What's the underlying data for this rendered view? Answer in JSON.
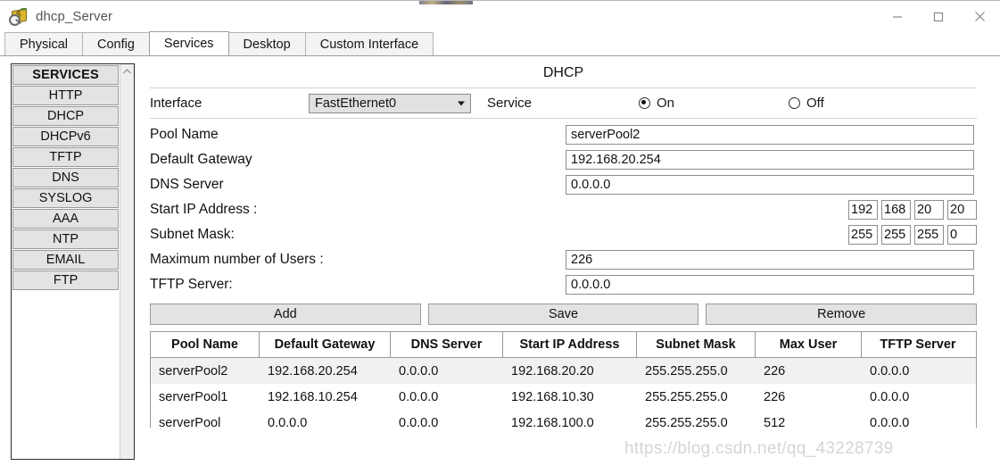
{
  "window": {
    "title": "dhcp_Server",
    "icon": "server-money-icon",
    "controls": {
      "minimize": "minimize-icon",
      "maximize": "maximize-icon",
      "close": "close-icon"
    }
  },
  "tabs": [
    {
      "label": "Physical",
      "active": false
    },
    {
      "label": "Config",
      "active": false
    },
    {
      "label": "Services",
      "active": true
    },
    {
      "label": "Desktop",
      "active": false
    },
    {
      "label": "Custom Interface",
      "active": false
    }
  ],
  "sidebar": {
    "header": "SERVICES",
    "items": [
      {
        "label": "HTTP"
      },
      {
        "label": "DHCP"
      },
      {
        "label": "DHCPv6"
      },
      {
        "label": "TFTP"
      },
      {
        "label": "DNS"
      },
      {
        "label": "SYSLOG"
      },
      {
        "label": "AAA"
      },
      {
        "label": "NTP"
      },
      {
        "label": "EMAIL"
      },
      {
        "label": "FTP"
      }
    ],
    "scroll_up_icon": "chevron-up-icon"
  },
  "panel": {
    "title": "DHCP",
    "interface_label": "Interface",
    "interface_value": "FastEthernet0",
    "interface_options": [
      "FastEthernet0"
    ],
    "service_label": "Service",
    "service_on_label": "On",
    "service_off_label": "Off",
    "service_state": "On"
  },
  "form": {
    "pool_name_label": "Pool Name",
    "pool_name_value": "serverPool2",
    "default_gateway_label": "Default Gateway",
    "default_gateway_value": "192.168.20.254",
    "dns_server_label": "DNS Server",
    "dns_server_value": "0.0.0.0",
    "start_ip_label": "Start IP Address :",
    "start_ip_octets": [
      "192",
      "168",
      "20",
      "20"
    ],
    "subnet_mask_label": "Subnet Mask:",
    "subnet_mask_octets": [
      "255",
      "255",
      "255",
      "0"
    ],
    "max_users_label": "Maximum number of Users :",
    "max_users_value": "226",
    "tftp_server_label": "TFTP Server:",
    "tftp_server_value": "0.0.0.0"
  },
  "buttons": {
    "add": "Add",
    "save": "Save",
    "remove": "Remove"
  },
  "table": {
    "headers": [
      "Pool Name",
      "Default Gateway",
      "DNS Server",
      "Start IP Address",
      "Subnet Mask",
      "Max User",
      "TFTP Server"
    ],
    "rows": [
      [
        "serverPool2",
        "192.168.20.254",
        "0.0.0.0",
        "192.168.20.20",
        "255.255.255.0",
        "226",
        "0.0.0.0"
      ],
      [
        "serverPool1",
        "192.168.10.254",
        "0.0.0.0",
        "192.168.10.30",
        "255.255.255.0",
        "226",
        "0.0.0.0"
      ],
      [
        "serverPool",
        "0.0.0.0",
        "0.0.0.0",
        "192.168.100.0",
        "255.255.255.0",
        "512",
        "0.0.0.0"
      ]
    ]
  },
  "watermark": "https://blog.csdn.net/qq_43228739"
}
